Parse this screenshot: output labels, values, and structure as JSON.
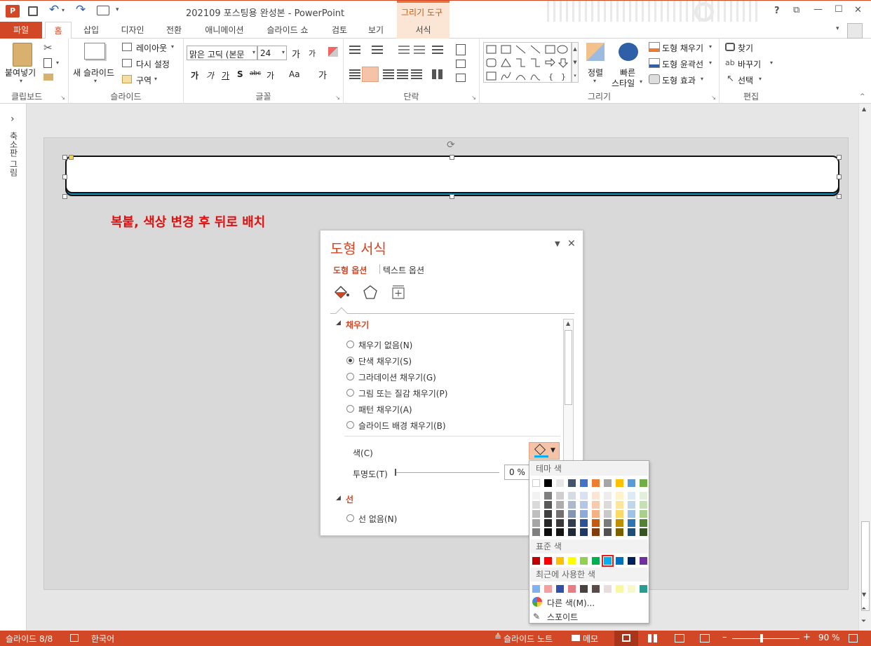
{
  "window": {
    "title": "202109 포스팅용 완성본 - PowerPoint",
    "context_tab_title": "그리기 도구",
    "help": "?",
    "restore": "⧉",
    "minimize": "—",
    "maximize": "☐",
    "close": "✕"
  },
  "tabs": [
    "파일",
    "홈",
    "삽입",
    "디자인",
    "전환",
    "애니메이션",
    "슬라이드 쇼",
    "검토",
    "보기",
    "서식"
  ],
  "ribbon": {
    "clipboard": {
      "label": "클립보드",
      "paste": "붙여넣기"
    },
    "slides": {
      "label": "슬라이드",
      "new_slide": "새 슬라이드",
      "layout": "레이아웃",
      "reset": "다시 설정",
      "section": "구역"
    },
    "font": {
      "label": "글꼴",
      "font_name": "맑은 고딕 (본문",
      "font_size": "24",
      "grow": "가",
      "shrink": "가",
      "bold": "가",
      "italic": "가",
      "underline": "가",
      "shadow": "S",
      "strike": "abc",
      "spacing": "가",
      "case": "Aa",
      "color": "가"
    },
    "paragraph": {
      "label": "단락"
    },
    "drawing": {
      "label": "그리기",
      "arrange": "정렬",
      "quick_styles_1": "빠른",
      "quick_styles_2": "스타일",
      "fill": "도형 채우기",
      "outline": "도형 윤곽선",
      "effects": "도형 효과"
    },
    "editing": {
      "label": "편집",
      "find": "찾기",
      "replace": "바꾸기",
      "select": "선택"
    }
  },
  "leftpane": {
    "toggle": "›",
    "label": "축소판 그림"
  },
  "slide": {
    "annotation": "복붙, 색상 변경 후 뒤로 배치"
  },
  "panel": {
    "title": "도형 서식",
    "tab_shape": "도형 옵션",
    "tab_text": "텍스트 옵션",
    "section_fill": "채우기",
    "fill_options": [
      "채우기 없음(N)",
      "단색 채우기(S)",
      "그라데이션 채우기(G)",
      "그림 또는 질감 채우기(P)",
      "패턴 채우기(A)",
      "슬라이드 배경 채우기(B)"
    ],
    "selected_fill": 1,
    "color_label": "색(C)",
    "transparency_label": "투명도(T)",
    "transparency_value": "0 %",
    "section_line": "선",
    "line_option": "선 없음(N)"
  },
  "palette": {
    "theme_header": "테마 색",
    "standard_header": "표준 색",
    "recent_header": "최근에 사용한 색",
    "more_colors": "다른 색(M)...",
    "eyedropper": "스포이트",
    "theme_top": [
      "#FFFFFF",
      "#000000",
      "#E7E6E6",
      "#44546A",
      "#4472C4",
      "#ED7D31",
      "#A5A5A5",
      "#FFC000",
      "#5B9BD5",
      "#70AD47"
    ],
    "theme_shades": [
      [
        "#F2F2F2",
        "#D9D9D9",
        "#BFBFBF",
        "#A6A6A6",
        "#808080"
      ],
      [
        "#808080",
        "#595959",
        "#404040",
        "#262626",
        "#0D0D0D"
      ],
      [
        "#D0CECE",
        "#AFABAB",
        "#767171",
        "#3B3838",
        "#171616"
      ],
      [
        "#D6DCE4",
        "#ADB9CA",
        "#8497B0",
        "#333F4F",
        "#222A35"
      ],
      [
        "#D9E2F3",
        "#B4C6E7",
        "#8EAADB",
        "#2F5496",
        "#1F3864"
      ],
      [
        "#FBE5D5",
        "#F7CBAC",
        "#F4B183",
        "#C55A11",
        "#833C0B"
      ],
      [
        "#EDEDED",
        "#DBDBDB",
        "#C9C9C9",
        "#7B7B7B",
        "#525252"
      ],
      [
        "#FFF2CC",
        "#FFE599",
        "#FFD966",
        "#BF8F00",
        "#7F6000"
      ],
      [
        "#DEEBF6",
        "#BDD7EE",
        "#9DC3E6",
        "#2E75B5",
        "#1F4E79"
      ],
      [
        "#E2EFD9",
        "#C5E0B3",
        "#A8D08D",
        "#538135",
        "#375623"
      ]
    ],
    "standard": [
      "#C00000",
      "#FF0000",
      "#FFC000",
      "#FFFF00",
      "#92D050",
      "#00B050",
      "#00B0F0",
      "#0070C0",
      "#002060",
      "#7030A0"
    ],
    "standard_selected": 6,
    "recent": [
      "#7FB2F0",
      "#F4A0A0",
      "#2F4FA8",
      "#E87C84",
      "#4A4040",
      "#5A4A48",
      "#E8DCDC",
      "#F8F8A0",
      "#F8F8C8",
      "#2A9D8F"
    ]
  },
  "status": {
    "slide_info": "슬라이드 8/8",
    "language": "한국어",
    "notes": "슬라이드 노트",
    "comments": "메모",
    "zoom": "90 %",
    "minus": "–",
    "plus": "+"
  }
}
